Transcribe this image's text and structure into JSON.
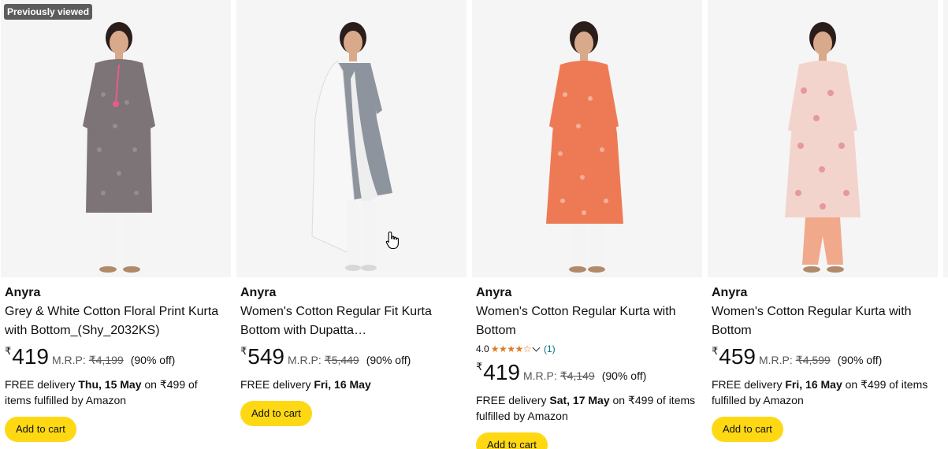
{
  "products": [
    {
      "badge": "Previously viewed",
      "brand": "Anyra",
      "title_line1": "Grey & White Cotton Floral Print Kurta",
      "title_line2": "with Bottom_(Shy_2032KS)",
      "currency": "₹",
      "price": "419",
      "mrp_label": "M.R.P:",
      "mrp": "₹4,199",
      "discount": "(90% off)",
      "delivery_prefix": "FREE delivery ",
      "delivery_date": "Thu, 15 May",
      "delivery_suffix": " on ₹499 of items fulfilled by Amazon",
      "button_label": "Add to cart",
      "image_icon": "kurta-product-image",
      "colors": {
        "kurta": "#7d7478",
        "pattern": "#a48f99",
        "bottom": "#f4f4f4"
      }
    },
    {
      "brand": "Anyra",
      "title_line1": "Women's Cotton Regular Fit Kurta",
      "title_line2": "Bottom with Dupatta…",
      "currency": "₹",
      "price": "549",
      "mrp_label": "M.R.P:",
      "mrp": "₹5,449",
      "discount": "(90% off)",
      "delivery_prefix": "FREE delivery ",
      "delivery_date": "Fri, 16 May",
      "delivery_suffix": "",
      "button_label": "Add to cart",
      "image_icon": "kurta-dupatta-product-image",
      "colors": {
        "kurta": "#8e949e",
        "dupatta": "#f7f7f7",
        "bottom": "#f4f4f4"
      }
    },
    {
      "brand": "Anyra",
      "title_line1": "Women's Cotton Regular Kurta with",
      "title_line2": "Bottom",
      "rating_value": "4.0",
      "rating": 4.0,
      "rating_count": "(1)",
      "currency": "₹",
      "price": "419",
      "mrp_label": "M.R.P:",
      "mrp": "₹4,149",
      "discount": "(90% off)",
      "delivery_prefix": "FREE delivery ",
      "delivery_date": "Sat, 17 May",
      "delivery_suffix": " on ₹499 of items fulfilled by Amazon",
      "button_label": "Add to cart",
      "image_icon": "kurta-product-image",
      "colors": {
        "kurta": "#ee7a55",
        "pattern": "#f4b6a0",
        "bottom": "#f4f4f4"
      }
    },
    {
      "brand": "Anyra",
      "title_line1": "Women's Cotton Regular Kurta with",
      "title_line2": "Bottom",
      "currency": "₹",
      "price": "459",
      "mrp_label": "M.R.P:",
      "mrp": "₹4,599",
      "discount": "(90% off)",
      "delivery_prefix": "FREE delivery ",
      "delivery_date": "Fri, 16 May",
      "delivery_suffix": " on ₹499 of items fulfilled by Amazon",
      "button_label": "Add to cart",
      "image_icon": "kurta-product-image",
      "colors": {
        "kurta": "#f3d4cc",
        "pattern": "#e28f92",
        "bottom": "#f1a98c"
      }
    }
  ],
  "theme": {
    "button_color": "#ffd814",
    "star_color": "#de7921",
    "link_color": "#007185",
    "muted_text": "#565959"
  },
  "pointer_icon": "hand-pointer-icon"
}
